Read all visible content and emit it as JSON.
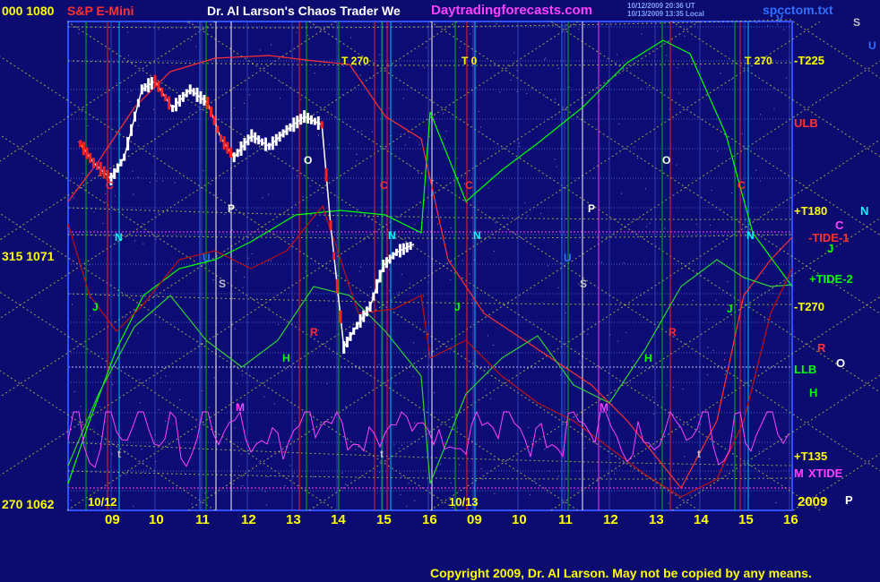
{
  "header": {
    "left_axis_top": "000  1080",
    "instrument": "S&P E-Mini",
    "title": "Dr. Al Larson's Chaos Trader We",
    "site": "Daytradingforecasts.com",
    "stamp_line1": "10/12/2009 20:36 UT",
    "stamp_line2": "10/13/2009 13:35 Local",
    "filename": "spcctom.txt",
    "corner_v": "V",
    "corner_s": "S",
    "corner_u": "U"
  },
  "left_axis": {
    "mid": "315  1071",
    "bottom": "270  1062"
  },
  "right_labels": [
    {
      "text": "-T225",
      "color": "#ffff00"
    },
    {
      "text": "ULB",
      "color": "#ff3030"
    },
    {
      "text": "+T180",
      "color": "#ffff00"
    },
    {
      "text": "N",
      "color": "#00ffff"
    },
    {
      "text": "C",
      "color": "#ff40ff"
    },
    {
      "text": "-TIDE-1",
      "color": "#ff3030"
    },
    {
      "text": "J",
      "color": "#00ff00"
    },
    {
      "text": "+TIDE-2",
      "color": "#00ff00"
    },
    {
      "text": "-T270",
      "color": "#ffff00"
    },
    {
      "text": "R",
      "color": "#ff3030"
    },
    {
      "text": "LLB",
      "color": "#00ff00"
    },
    {
      "text": "O",
      "color": "#ffffff"
    },
    {
      "text": "H",
      "color": "#00ff00"
    },
    {
      "text": "+T135",
      "color": "#ffff00"
    },
    {
      "text": "M",
      "color": "#ff40ff"
    },
    {
      "text": "XTIDE",
      "color": "#ff40ff"
    },
    {
      "text": "P",
      "color": "#ffffff"
    }
  ],
  "date_labels": {
    "day1": "10/12",
    "day2": "10/13",
    "year": "2009"
  },
  "x_axis": {
    "ticks": [
      "09",
      "10",
      "11",
      "12",
      "13",
      "14",
      "15",
      "16",
      "09",
      "10",
      "11",
      "12",
      "13",
      "14",
      "15",
      "16"
    ]
  },
  "footer": {
    "copyright": "Copyright 2009, Dr. Al Larson. May not be copied by any means."
  },
  "chart_data": {
    "type": "line",
    "title": "S&P E-Mini",
    "ylim": [
      1062,
      1080
    ],
    "y_ticks": [
      "1080",
      "1071",
      "1062"
    ],
    "x_ticks": [
      "09",
      "10",
      "11",
      "12",
      "13",
      "14",
      "15",
      "16",
      "09",
      "10",
      "11",
      "12",
      "13",
      "14",
      "15",
      "16"
    ],
    "sessions": [
      "10/12",
      "10/13"
    ],
    "price_approx": {
      "x_hours": [
        8.3,
        8.6,
        9.0,
        9.3,
        9.7,
        10.0,
        10.4,
        10.8,
        11.2,
        11.5,
        11.8,
        12.2,
        12.6,
        13.0,
        13.4,
        13.8,
        14.0,
        14.3,
        14.6,
        14.9,
        15.2,
        15.5,
        15.9
      ],
      "y_price": [
        1075.5,
        1074.8,
        1074.2,
        1075.0,
        1077.5,
        1077.8,
        1076.8,
        1077.5,
        1077.0,
        1075.7,
        1075.0,
        1075.8,
        1075.4,
        1076.0,
        1076.5,
        1076.2,
        1072.5,
        1068.0,
        1068.8,
        1069.5,
        1071.0,
        1071.5,
        1071.8
      ]
    },
    "annotations": [
      "T 270",
      "T 0",
      "T 270",
      "C",
      "N",
      "J",
      "U",
      "S",
      "P",
      "O",
      "R",
      "H",
      "M",
      "t"
    ],
    "grid": true
  }
}
